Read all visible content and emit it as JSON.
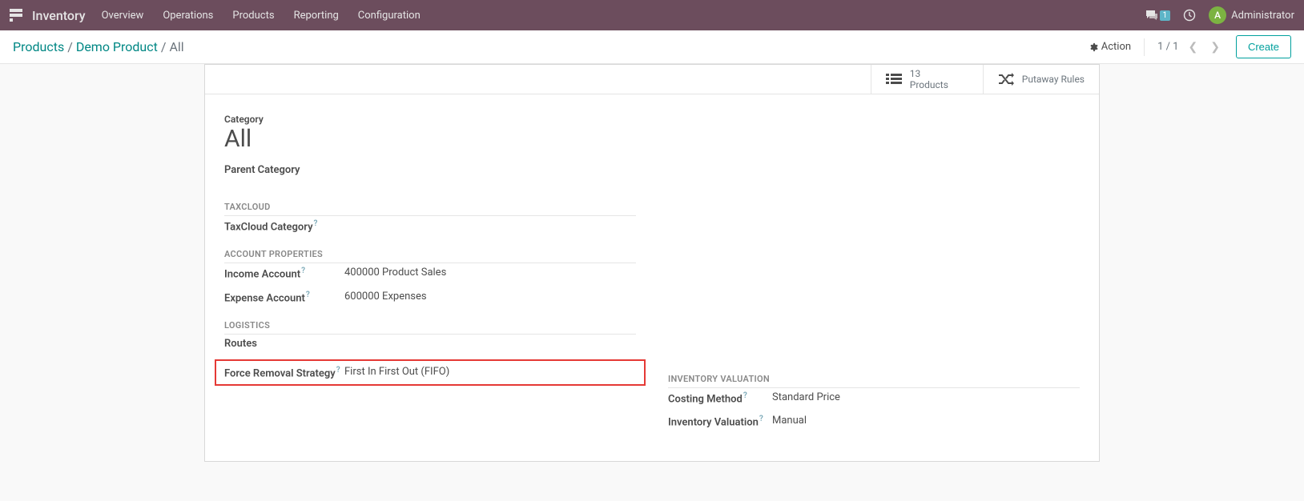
{
  "topnav": {
    "brand": "Inventory",
    "items": [
      "Overview",
      "Operations",
      "Products",
      "Reporting",
      "Configuration"
    ],
    "chat_count": "1",
    "user_initial": "A",
    "user_name": "Administrator"
  },
  "ctrl": {
    "crumbs": [
      "Products",
      "Demo Product"
    ],
    "current": "All",
    "action_label": "Action",
    "pager": "1 / 1",
    "create_label": "Create"
  },
  "stats": {
    "products_count": "13",
    "products_label": "Products",
    "putaway_label": "Putaway Rules"
  },
  "record": {
    "cat_label": "Category",
    "cat_name": "All",
    "parent_label": "Parent Category",
    "parent_value": "",
    "sections": {
      "taxcloud": {
        "title": "TAXCLOUD",
        "taxcloud_cat_label": "TaxCloud Category",
        "taxcloud_cat_value": ""
      },
      "account": {
        "title": "ACCOUNT PROPERTIES",
        "income_label": "Income Account",
        "income_value": "400000 Product Sales",
        "expense_label": "Expense Account",
        "expense_value": "600000 Expenses"
      },
      "logistics": {
        "title": "LOGISTICS",
        "routes_label": "Routes",
        "routes_value": "",
        "removal_label": "Force Removal Strategy",
        "removal_value": "First In First Out (FIFO)"
      },
      "valuation": {
        "title": "INVENTORY VALUATION",
        "costing_label": "Costing Method",
        "costing_value": "Standard Price",
        "inv_val_label": "Inventory Valuation",
        "inv_val_value": "Manual"
      }
    }
  }
}
